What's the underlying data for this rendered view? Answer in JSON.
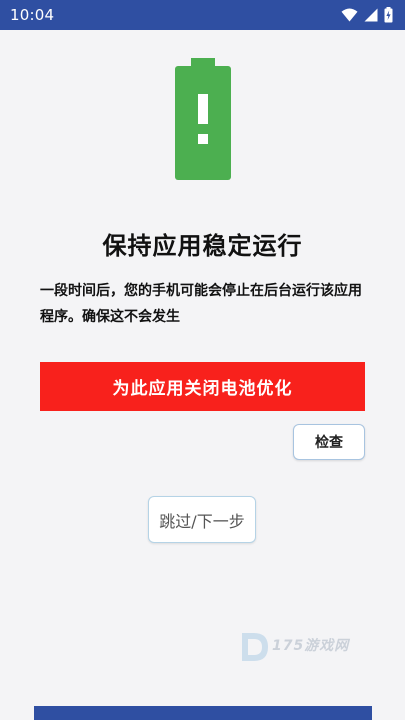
{
  "status_bar": {
    "time": "10:04",
    "icons": [
      "wifi-icon",
      "cellular-signal-icon",
      "battery-charging-icon"
    ]
  },
  "illustration": {
    "icon": "battery-warning-icon",
    "color": "#4caf50"
  },
  "main": {
    "title": "保持应用稳定运行",
    "description": "一段时间后，您的手机可能会停止在后台运行该应用程序。确保这不会发生",
    "optimize_button_label": "为此应用关闭电池优化",
    "check_button_label": "检查",
    "skip_button_label": "跳过/下一步"
  },
  "watermark": {
    "text": "175游戏网"
  },
  "colors": {
    "status_bar": "#2f4fa2",
    "primary_button": "#f8211c",
    "background": "#f4f4f6"
  }
}
